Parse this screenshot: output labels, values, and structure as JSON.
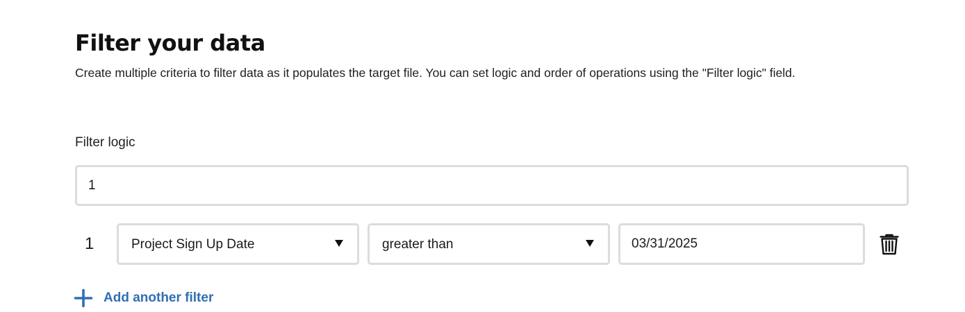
{
  "header": {
    "title": "Filter your data",
    "description": "Create multiple criteria to filter data as it populates the target file. You can set logic and order of operations using the \"Filter logic\" field."
  },
  "filter_logic": {
    "label": "Filter logic",
    "value": "1"
  },
  "filters": [
    {
      "number": "1",
      "field": "Project Sign Up Date",
      "operator": "greater than",
      "value": "03/31/2025"
    }
  ],
  "add_filter": {
    "label": "Add another filter"
  },
  "colors": {
    "accent": "#2f6fb3",
    "border": "#dcdcdc",
    "text": "#1a1a1a"
  },
  "icons": {
    "delete": "trash-icon",
    "add": "plus-icon",
    "dropdown": "caret-down-icon"
  }
}
